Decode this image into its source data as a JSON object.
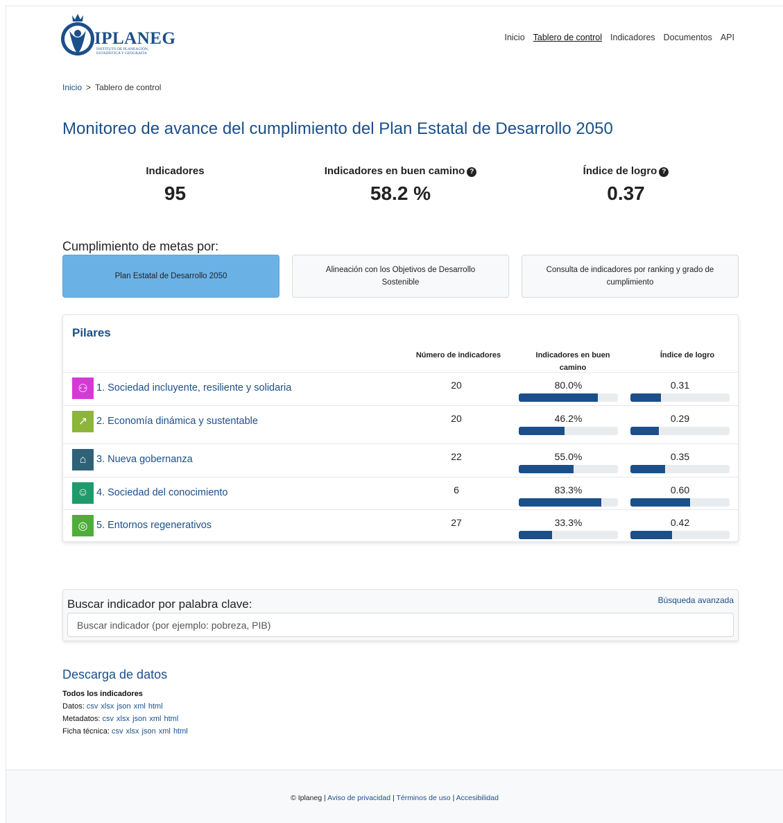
{
  "brand": {
    "name": "IPLANEG",
    "subtitle": "INSTITUTO DE PLANEACIÓN, ESTADÍSTICA Y GEOGRAFÍA"
  },
  "nav": {
    "items": [
      {
        "label": "Inicio",
        "active": false
      },
      {
        "label": "Tablero de control",
        "active": true
      },
      {
        "label": "Indicadores",
        "active": false
      },
      {
        "label": "Documentos",
        "active": false
      },
      {
        "label": "API",
        "active": false
      }
    ]
  },
  "breadcrumb": {
    "home": "Inicio",
    "separator": ">",
    "current": "Tablero de control"
  },
  "page_title": "Monitoreo de avance del cumplimiento del Plan Estatal de Desarrollo 2050",
  "kpis": [
    {
      "label": "Indicadores",
      "value": "95",
      "help": false
    },
    {
      "label": "Indicadores en buen camino",
      "value": "58.2 %",
      "help": true
    },
    {
      "label": "Índice de logro",
      "value": "0.37",
      "help": true
    }
  ],
  "goals": {
    "label": "Cumplimiento de metas por:",
    "buttons": [
      {
        "label": "Plan Estatal de Desarrollo 2050",
        "active": true
      },
      {
        "label": "Alineación con los Objetivos de Desarrollo Sostenible",
        "active": false
      },
      {
        "label": "Consulta de indicadores por ranking y grado de cumplimiento",
        "active": false
      }
    ]
  },
  "pillars": {
    "title": "Pilares",
    "columns": {
      "count": "Número de indicadores",
      "on_track": "Indicadores en buen camino",
      "index": "Índice de logro"
    },
    "rows": [
      {
        "name": "1. Sociedad incluyente, resiliente y solidaria",
        "icon": "people-icon",
        "icon_color": "#d63ad6",
        "count": "20",
        "on_track": "80.0%",
        "on_track_value": 0.8,
        "index": "0.31",
        "index_value": 0.31
      },
      {
        "name": "2. Economía dinámica y sustentable",
        "icon": "growth-chart-icon",
        "icon_color": "#8db53a",
        "count": "20",
        "on_track": "46.2%",
        "on_track_value": 0.462,
        "index": "0.29",
        "index_value": 0.29
      },
      {
        "name": "3. Nueva gobernanza",
        "icon": "government-building-icon",
        "icon_color": "#2f6177",
        "count": "22",
        "on_track": "55.0%",
        "on_track_value": 0.55,
        "index": "0.35",
        "index_value": 0.35
      },
      {
        "name": "4. Sociedad del conocimiento",
        "icon": "head-idea-icon",
        "icon_color": "#1f9a6b",
        "count": "6",
        "on_track": "83.3%",
        "on_track_value": 0.833,
        "index": "0.60",
        "index_value": 0.6
      },
      {
        "name": "5. Entornos regenerativos",
        "icon": "globe-leaf-icon",
        "icon_color": "#4fae3a",
        "count": "27",
        "on_track": "33.3%",
        "on_track_value": 0.333,
        "index": "0.42",
        "index_value": 0.42
      }
    ]
  },
  "search": {
    "label": "Buscar indicador por palabra clave:",
    "advanced": "Búsqueda avanzada",
    "placeholder": "Buscar indicador (por ejemplo: pobreza, PIB)"
  },
  "downloads": {
    "title": "Descarga de datos",
    "subtitle": "Todos los indicadores",
    "groups": [
      {
        "label": "Datos:",
        "formats": [
          "csv",
          "xlsx",
          "json",
          "xml",
          "html"
        ]
      },
      {
        "label": "Metadatos:",
        "formats": [
          "csv",
          "xlsx",
          "json",
          "xml",
          "html"
        ]
      },
      {
        "label": "Ficha técnica:",
        "formats": [
          "csv",
          "xlsx",
          "json",
          "xml",
          "html"
        ]
      }
    ]
  },
  "footer": {
    "copyright": "© Iplaneg",
    "links": [
      "Aviso de privacidad",
      "Términos de uso",
      "Accesibilidad"
    ],
    "separator": "|"
  }
}
